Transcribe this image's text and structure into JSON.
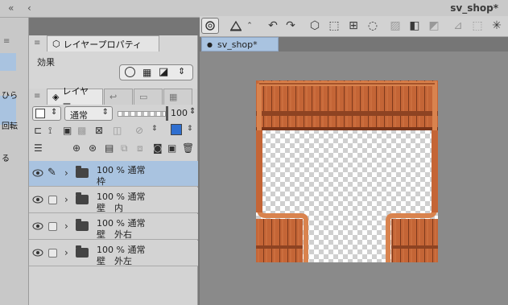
{
  "title": "sv_shop*",
  "props_tab": "レイヤープロパティ",
  "effects_label": "効果",
  "layer_tab": "レイヤー",
  "blend_mode": "通常",
  "opacity_value": "100",
  "canvas_tab": "sv_shop*",
  "left_texts": [
    "ひら",
    "回転",
    "る"
  ],
  "layers": [
    {
      "line1": "100 % 通常",
      "line2": "枠",
      "selected": true
    },
    {
      "line1": "100 % 通常",
      "line2": "壁　内",
      "selected": false
    },
    {
      "line1": "100 % 通常",
      "line2": "壁　外右",
      "selected": false
    },
    {
      "line1": "100 % 通常",
      "line2": "壁　外左",
      "selected": false
    }
  ],
  "colors": {
    "accent": "#a9c3e0",
    "wood": "#c56a3a",
    "wood_dark": "#8e4322",
    "frame": "#d9834e"
  }
}
